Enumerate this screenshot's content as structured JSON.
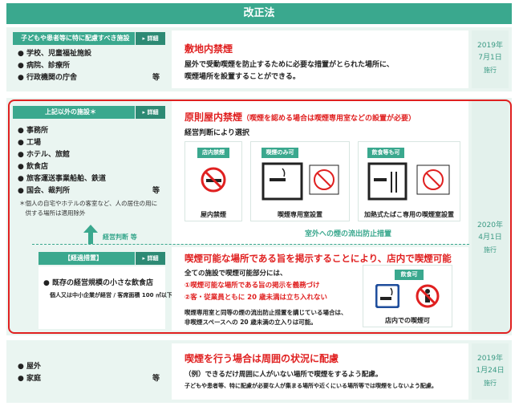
{
  "header": {
    "title": "改正法"
  },
  "sec1": {
    "tag": "子どもや患者等に特に配慮すべき施設",
    "detail": "▸ 詳細",
    "items": [
      "● 学校、児童福祉施設",
      "● 病院、診療所",
      "● 行政機関の庁舎"
    ],
    "etc": "等",
    "heading": "敷地内禁煙",
    "desc1": "屋外で受動喫煙を防止するために必要な措置がとられた場所に、",
    "desc2": "喫煙場所を設置することができる。",
    "date": [
      "2019年",
      "7月1日",
      "施行"
    ]
  },
  "sec2": {
    "tag": "上記以外の施設＊",
    "detail": "▸ 詳細",
    "items": [
      "● 事務所",
      "● 工場",
      "● ホテル、旅館",
      "● 飲食店",
      "● 旅客運送事業船舶、鉄道",
      "● 国会、裁判所"
    ],
    "etc": "等",
    "note1": "＊個人の自宅やホテルの客室など、人の居住の用に",
    "note2": "　供する場所は適用除外",
    "heading": "原則屋内禁煙",
    "heading_sub": "（喫煙を認める場合は喫煙専用室などの設置が必要）",
    "mgmt": "経営判断により選択",
    "card1_tag": "店内禁煙",
    "card1_caption": "屋内禁煙",
    "card2_tag": "喫煙のみ可",
    "card2_caption": "喫煙専用室設置",
    "card3_tag": "飲食等も可",
    "card3_caption": "加熱式たばこ専用の喫煙室設置",
    "outflow": "室外への煙の流出防止措置",
    "arrow_label": "経営判断 等",
    "date": [
      "2020年",
      "4月1日",
      "施行"
    ]
  },
  "sec3": {
    "tag": "【経過措置】",
    "detail": "▸ 詳細",
    "item": "● 既存の経営規模の小さな飲食店",
    "item_note": "個人又は中小企業が経営 / 客席面積 100 ㎡以下",
    "heading": "喫煙可能な場所である旨を掲示することにより、店内で喫煙可能",
    "line1": "全ての施設で喫煙可能部分には、",
    "line2": "①喫煙可能な場所である旨の掲示を義務づけ",
    "line3": "②客・従業員ともに 20 歳未満は立ち入れない",
    "line4": "喫煙専用室と同等の煙の流出防止措置を講じている場合は、",
    "line5": "非喫煙スペースへの 20 歳未満の立入りは可能。",
    "card_tag": "飲食可",
    "card_caption": "店内での喫煙可"
  },
  "sec4": {
    "items": [
      "● 屋外",
      "● 家庭"
    ],
    "etc": "等",
    "heading": "喫煙を行う場合は周囲の状況に配慮",
    "desc1": "（例）できるだけ周囲に人がいない場所で喫煙をするよう配慮。",
    "desc2": "子どもや患者等、特に配慮が必要な人が集まる場所や近くにいる場所等では喫煙をしないよう配慮。",
    "date": [
      "2019年",
      "1月24日",
      "施行"
    ]
  }
}
